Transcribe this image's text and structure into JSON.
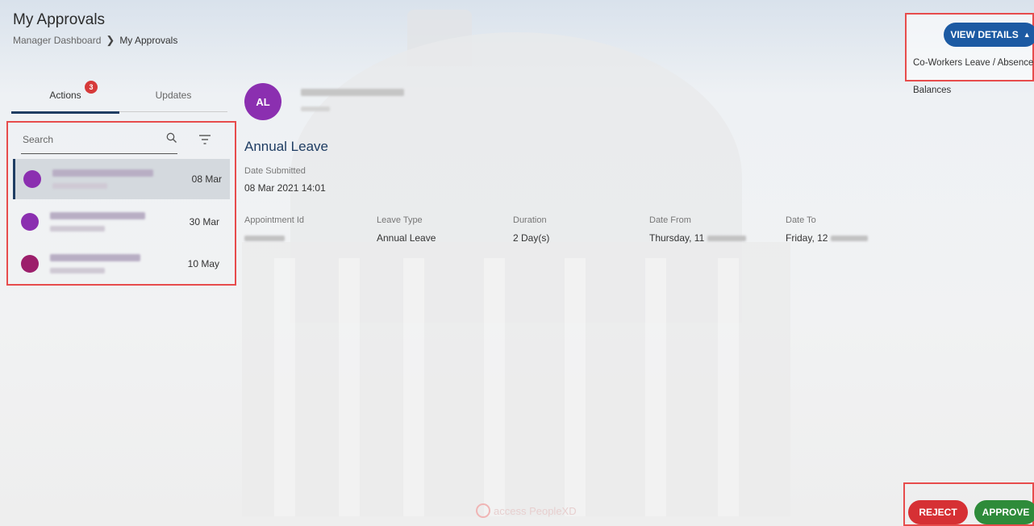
{
  "header": {
    "title": "My Approvals",
    "breadcrumb_parent": "Manager Dashboard",
    "breadcrumb_current": "My Approvals"
  },
  "view_details": {
    "button_label": "VIEW DETAILS",
    "items": [
      "Co-Workers Leave / Absence",
      "Balances"
    ]
  },
  "tabs": {
    "actions_label": "Actions",
    "actions_badge": "3",
    "updates_label": "Updates"
  },
  "search": {
    "placeholder": "Search"
  },
  "list": [
    {
      "date": "08 Mar",
      "avatar_color": "#8b2fb0",
      "selected": true
    },
    {
      "date": "30 Mar",
      "avatar_color": "#8b2fb0",
      "selected": false
    },
    {
      "date": "10 May",
      "avatar_color": "#9c1f6b",
      "selected": false
    }
  ],
  "detail": {
    "avatar_initials": "AL",
    "leave_title": "Annual Leave",
    "date_submitted_label": "Date Submitted",
    "date_submitted_value": "08 Mar 2021 14:01",
    "appointment_label": "Appointment Id",
    "leave_type_label": "Leave Type",
    "leave_type_value": "Annual Leave",
    "duration_label": "Duration",
    "duration_value": "2 Day(s)",
    "date_from_label": "Date From",
    "date_from_value": "Thursday, 11",
    "date_to_label": "Date To",
    "date_to_value": "Friday, 12"
  },
  "footer": {
    "logo_text": "access PeopleXD",
    "reject_label": "REJECT",
    "approve_label": "APPROVE"
  },
  "colors": {
    "primary": "#1c5aa3",
    "navy": "#1f3d63",
    "reject": "#d63034",
    "approve": "#2e8b3a",
    "badge": "#d63a3a",
    "highlight_border": "#e74c4c"
  }
}
